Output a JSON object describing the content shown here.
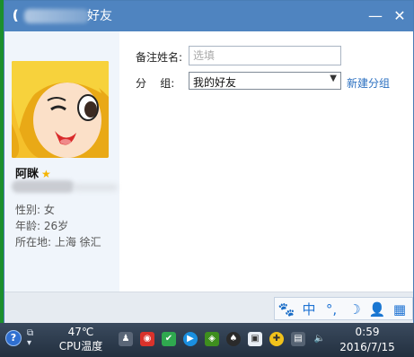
{
  "window": {
    "title_suffix": "好友",
    "minimize_glyph": "—",
    "close_glyph": "✕"
  },
  "profile": {
    "name": "阿眯",
    "star": "★",
    "gender": "性别: 女",
    "age": "年龄: 26岁",
    "location": "所在地: 上海  徐汇"
  },
  "form": {
    "remark_label": "备注姓名:",
    "remark_placeholder": "选填",
    "group_label": "分    组:",
    "group_value": "我的好友",
    "new_group_link": "新建分组"
  },
  "ime": {
    "items": [
      "🐾",
      "中",
      "°,",
      "☽",
      "👤",
      "▦"
    ]
  },
  "taskbar": {
    "temperature": "47℃",
    "cpu_label": "CPU温度",
    "time": "0:59",
    "date": "2016/7/15"
  },
  "colors": {
    "titlebar": "#4f84c0",
    "link": "#2a6fc0",
    "ime_accent": "#1f73d3"
  }
}
